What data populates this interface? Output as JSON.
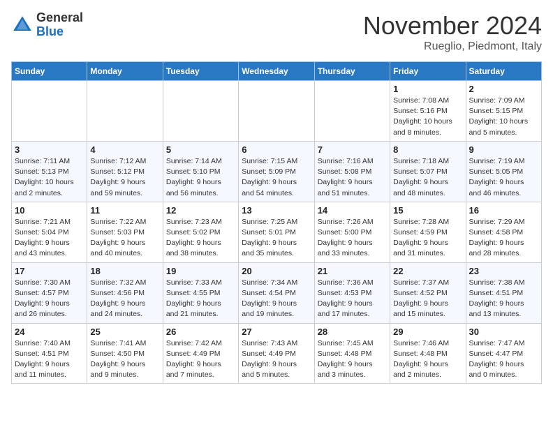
{
  "header": {
    "logo_general": "General",
    "logo_blue": "Blue",
    "month_title": "November 2024",
    "subtitle": "Rueglio, Piedmont, Italy"
  },
  "weekdays": [
    "Sunday",
    "Monday",
    "Tuesday",
    "Wednesday",
    "Thursday",
    "Friday",
    "Saturday"
  ],
  "weeks": [
    [
      {
        "day": "",
        "info": ""
      },
      {
        "day": "",
        "info": ""
      },
      {
        "day": "",
        "info": ""
      },
      {
        "day": "",
        "info": ""
      },
      {
        "day": "",
        "info": ""
      },
      {
        "day": "1",
        "info": "Sunrise: 7:08 AM\nSunset: 5:16 PM\nDaylight: 10 hours\nand 8 minutes."
      },
      {
        "day": "2",
        "info": "Sunrise: 7:09 AM\nSunset: 5:15 PM\nDaylight: 10 hours\nand 5 minutes."
      }
    ],
    [
      {
        "day": "3",
        "info": "Sunrise: 7:11 AM\nSunset: 5:13 PM\nDaylight: 10 hours\nand 2 minutes."
      },
      {
        "day": "4",
        "info": "Sunrise: 7:12 AM\nSunset: 5:12 PM\nDaylight: 9 hours\nand 59 minutes."
      },
      {
        "day": "5",
        "info": "Sunrise: 7:14 AM\nSunset: 5:10 PM\nDaylight: 9 hours\nand 56 minutes."
      },
      {
        "day": "6",
        "info": "Sunrise: 7:15 AM\nSunset: 5:09 PM\nDaylight: 9 hours\nand 54 minutes."
      },
      {
        "day": "7",
        "info": "Sunrise: 7:16 AM\nSunset: 5:08 PM\nDaylight: 9 hours\nand 51 minutes."
      },
      {
        "day": "8",
        "info": "Sunrise: 7:18 AM\nSunset: 5:07 PM\nDaylight: 9 hours\nand 48 minutes."
      },
      {
        "day": "9",
        "info": "Sunrise: 7:19 AM\nSunset: 5:05 PM\nDaylight: 9 hours\nand 46 minutes."
      }
    ],
    [
      {
        "day": "10",
        "info": "Sunrise: 7:21 AM\nSunset: 5:04 PM\nDaylight: 9 hours\nand 43 minutes."
      },
      {
        "day": "11",
        "info": "Sunrise: 7:22 AM\nSunset: 5:03 PM\nDaylight: 9 hours\nand 40 minutes."
      },
      {
        "day": "12",
        "info": "Sunrise: 7:23 AM\nSunset: 5:02 PM\nDaylight: 9 hours\nand 38 minutes."
      },
      {
        "day": "13",
        "info": "Sunrise: 7:25 AM\nSunset: 5:01 PM\nDaylight: 9 hours\nand 35 minutes."
      },
      {
        "day": "14",
        "info": "Sunrise: 7:26 AM\nSunset: 5:00 PM\nDaylight: 9 hours\nand 33 minutes."
      },
      {
        "day": "15",
        "info": "Sunrise: 7:28 AM\nSunset: 4:59 PM\nDaylight: 9 hours\nand 31 minutes."
      },
      {
        "day": "16",
        "info": "Sunrise: 7:29 AM\nSunset: 4:58 PM\nDaylight: 9 hours\nand 28 minutes."
      }
    ],
    [
      {
        "day": "17",
        "info": "Sunrise: 7:30 AM\nSunset: 4:57 PM\nDaylight: 9 hours\nand 26 minutes."
      },
      {
        "day": "18",
        "info": "Sunrise: 7:32 AM\nSunset: 4:56 PM\nDaylight: 9 hours\nand 24 minutes."
      },
      {
        "day": "19",
        "info": "Sunrise: 7:33 AM\nSunset: 4:55 PM\nDaylight: 9 hours\nand 21 minutes."
      },
      {
        "day": "20",
        "info": "Sunrise: 7:34 AM\nSunset: 4:54 PM\nDaylight: 9 hours\nand 19 minutes."
      },
      {
        "day": "21",
        "info": "Sunrise: 7:36 AM\nSunset: 4:53 PM\nDaylight: 9 hours\nand 17 minutes."
      },
      {
        "day": "22",
        "info": "Sunrise: 7:37 AM\nSunset: 4:52 PM\nDaylight: 9 hours\nand 15 minutes."
      },
      {
        "day": "23",
        "info": "Sunrise: 7:38 AM\nSunset: 4:51 PM\nDaylight: 9 hours\nand 13 minutes."
      }
    ],
    [
      {
        "day": "24",
        "info": "Sunrise: 7:40 AM\nSunset: 4:51 PM\nDaylight: 9 hours\nand 11 minutes."
      },
      {
        "day": "25",
        "info": "Sunrise: 7:41 AM\nSunset: 4:50 PM\nDaylight: 9 hours\nand 9 minutes."
      },
      {
        "day": "26",
        "info": "Sunrise: 7:42 AM\nSunset: 4:49 PM\nDaylight: 9 hours\nand 7 minutes."
      },
      {
        "day": "27",
        "info": "Sunrise: 7:43 AM\nSunset: 4:49 PM\nDaylight: 9 hours\nand 5 minutes."
      },
      {
        "day": "28",
        "info": "Sunrise: 7:45 AM\nSunset: 4:48 PM\nDaylight: 9 hours\nand 3 minutes."
      },
      {
        "day": "29",
        "info": "Sunrise: 7:46 AM\nSunset: 4:48 PM\nDaylight: 9 hours\nand 2 minutes."
      },
      {
        "day": "30",
        "info": "Sunrise: 7:47 AM\nSunset: 4:47 PM\nDaylight: 9 hours\nand 0 minutes."
      }
    ]
  ]
}
